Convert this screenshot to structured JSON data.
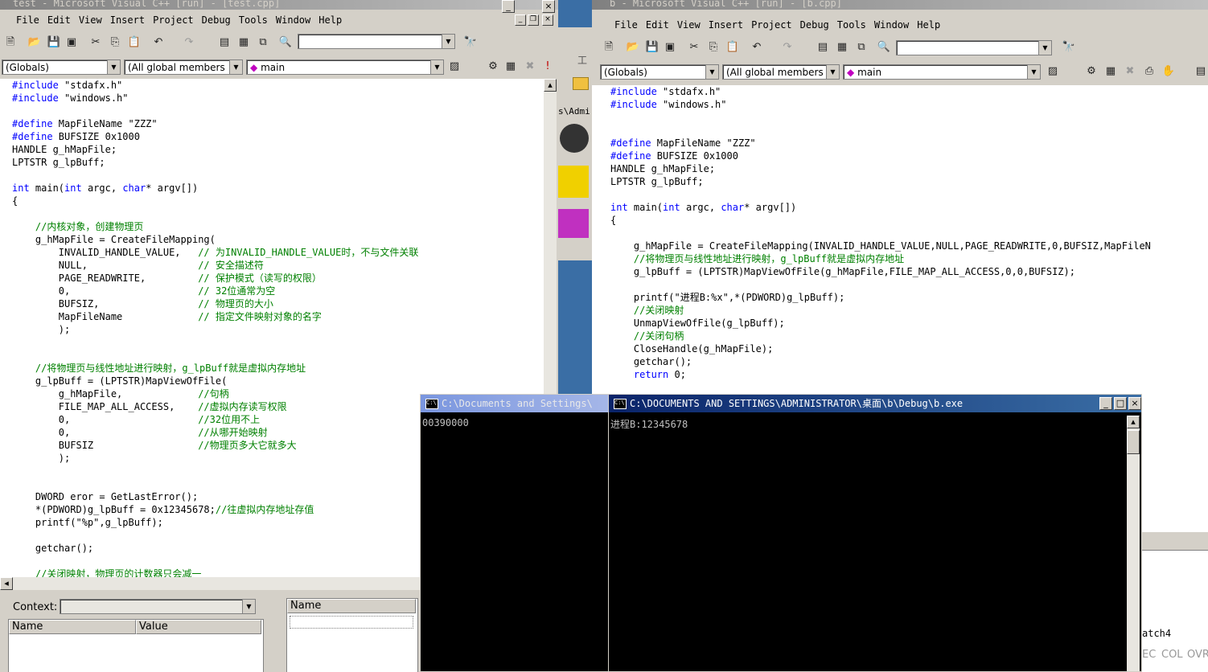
{
  "left_window": {
    "title": "test - Microsoft Visual C++ [run] - [test.cpp]",
    "menu": [
      "File",
      "Edit",
      "View",
      "Insert",
      "Project",
      "Debug",
      "Tools",
      "Window",
      "Help"
    ],
    "wizard": {
      "scope": "(Globals)",
      "members": "(All global members",
      "function": "main"
    },
    "code": [
      {
        "indent": "",
        "text": "#include \"stdafx.h\""
      },
      {
        "indent": "",
        "text": "#include \"windows.h\""
      },
      {
        "indent": "",
        "text": ""
      },
      {
        "indent": "",
        "text": "#define MapFileName \"ZZZ\""
      },
      {
        "indent": "",
        "text": "#define BUFSIZE 0x1000"
      },
      {
        "indent": "",
        "text": "HANDLE g_hMapFile;"
      },
      {
        "indent": "",
        "text": "LPTSTR g_lpBuff;"
      },
      {
        "indent": "",
        "text": ""
      },
      {
        "indent": "",
        "text": "int main(int argc, char* argv[])"
      },
      {
        "indent": "",
        "text": "{"
      },
      {
        "indent": "",
        "text": ""
      },
      {
        "indent": "    ",
        "text": "//内核对象，创建物理页"
      },
      {
        "indent": "    ",
        "text": "g_hMapFile = CreateFileMapping("
      },
      {
        "indent": "        ",
        "text": "INVALID_HANDLE_VALUE,   // 为INVALID_HANDLE_VALUE时，不与文件关联"
      },
      {
        "indent": "        ",
        "text": "NULL,                   // 安全描述符"
      },
      {
        "indent": "        ",
        "text": "PAGE_READWRITE,         // 保护模式（读写的权限）"
      },
      {
        "indent": "        ",
        "text": "0,                      // 32位通常为空"
      },
      {
        "indent": "        ",
        "text": "BUFSIZ,                 // 物理页的大小"
      },
      {
        "indent": "        ",
        "text": "MapFileName             // 指定文件映射对象的名字"
      },
      {
        "indent": "        ",
        "text": ");"
      },
      {
        "indent": "",
        "text": ""
      },
      {
        "indent": "",
        "text": ""
      },
      {
        "indent": "    ",
        "text": "//将物理页与线性地址进行映射，g_lpBuff就是虚拟内存地址"
      },
      {
        "indent": "    ",
        "text": "g_lpBuff = (LPTSTR)MapViewOfFile("
      },
      {
        "indent": "        ",
        "text": "g_hMapFile,             //句柄"
      },
      {
        "indent": "        ",
        "text": "FILE_MAP_ALL_ACCESS,    //虚拟内存读写权限"
      },
      {
        "indent": "        ",
        "text": "0,                      //32位用不上"
      },
      {
        "indent": "        ",
        "text": "0,                      //从哪开始映射"
      },
      {
        "indent": "        ",
        "text": "BUFSIZ                  //物理页多大它就多大"
      },
      {
        "indent": "        ",
        "text": ");"
      },
      {
        "indent": "",
        "text": ""
      },
      {
        "indent": "",
        "text": ""
      },
      {
        "indent": "    ",
        "text": "DWORD eror = GetLastError();"
      },
      {
        "indent": "    ",
        "text": "*(PDWORD)g_lpBuff = 0x12345678;//往虚拟内存地址存值"
      },
      {
        "indent": "    ",
        "text": "printf(\"%p\",g_lpBuff);"
      },
      {
        "indent": "",
        "text": ""
      },
      {
        "indent": "    ",
        "text": "getchar();"
      },
      {
        "indent": "",
        "text": ""
      },
      {
        "indent": "    ",
        "text": "//关闭映射，物理页的计数器只会减一"
      }
    ],
    "watch": {
      "context_label": "Context:",
      "col_name": "Name",
      "col_value": "Value"
    },
    "watch2": {
      "col_name": "Name"
    }
  },
  "background_window": {
    "labels": [
      "工",
      "s\\Admi"
    ]
  },
  "right_window": {
    "title": "b - Microsoft Visual C++ [run] - [b.cpp]",
    "menu": [
      "File",
      "Edit",
      "View",
      "Insert",
      "Project",
      "Debug",
      "Tools",
      "Window",
      "Help"
    ],
    "wizard": {
      "scope": "(Globals)",
      "members": "(All global members",
      "function": "main"
    },
    "code": [
      {
        "text": "#include \"stdafx.h\""
      },
      {
        "text": "#include \"windows.h\""
      },
      {
        "text": ""
      },
      {
        "text": ""
      },
      {
        "text": "#define MapFileName \"ZZZ\""
      },
      {
        "text": "#define BUFSIZE 0x1000"
      },
      {
        "text": "HANDLE g_hMapFile;"
      },
      {
        "text": "LPTSTR g_lpBuff;"
      },
      {
        "text": ""
      },
      {
        "text": "int main(int argc, char* argv[])"
      },
      {
        "text": "{"
      },
      {
        "text": ""
      },
      {
        "text": "    g_hMapFile = CreateFileMapping(INVALID_HANDLE_VALUE,NULL,PAGE_READWRITE,0,BUFSIZ,MapFileN"
      },
      {
        "text": "    //将物理页与线性地址进行映射，g_lpBuff就是虚拟内存地址"
      },
      {
        "text": "    g_lpBuff = (LPTSTR)MapViewOfFile(g_hMapFile,FILE_MAP_ALL_ACCESS,0,0,BUFSIZ);"
      },
      {
        "text": ""
      },
      {
        "text": "    printf(\"进程B:%x\",*(PDWORD)g_lpBuff);"
      },
      {
        "text": "    //关闭映射"
      },
      {
        "text": "    UnmapViewOfFile(g_lpBuff);"
      },
      {
        "text": "    //关闭句柄"
      },
      {
        "text": "    CloseHandle(g_hMapFile);"
      },
      {
        "text": "    getchar();"
      },
      {
        "text": "    return 0;"
      }
    ],
    "watch_tab": "atch4",
    "status": [
      "EC",
      "COL",
      "OVR"
    ]
  },
  "console_a": {
    "title": "C:\\Documents and Settings\\",
    "output": "00390000"
  },
  "console_b": {
    "title": "C:\\DOCUMENTS AND SETTINGS\\ADMINISTRATOR\\桌面\\b\\Debug\\b.exe",
    "output": "进程B:12345678"
  },
  "colors": {
    "keyword": "#0000ff",
    "comment": "#008000",
    "titlebar_active": "#0a246a",
    "chrome": "#d4d0c8"
  }
}
